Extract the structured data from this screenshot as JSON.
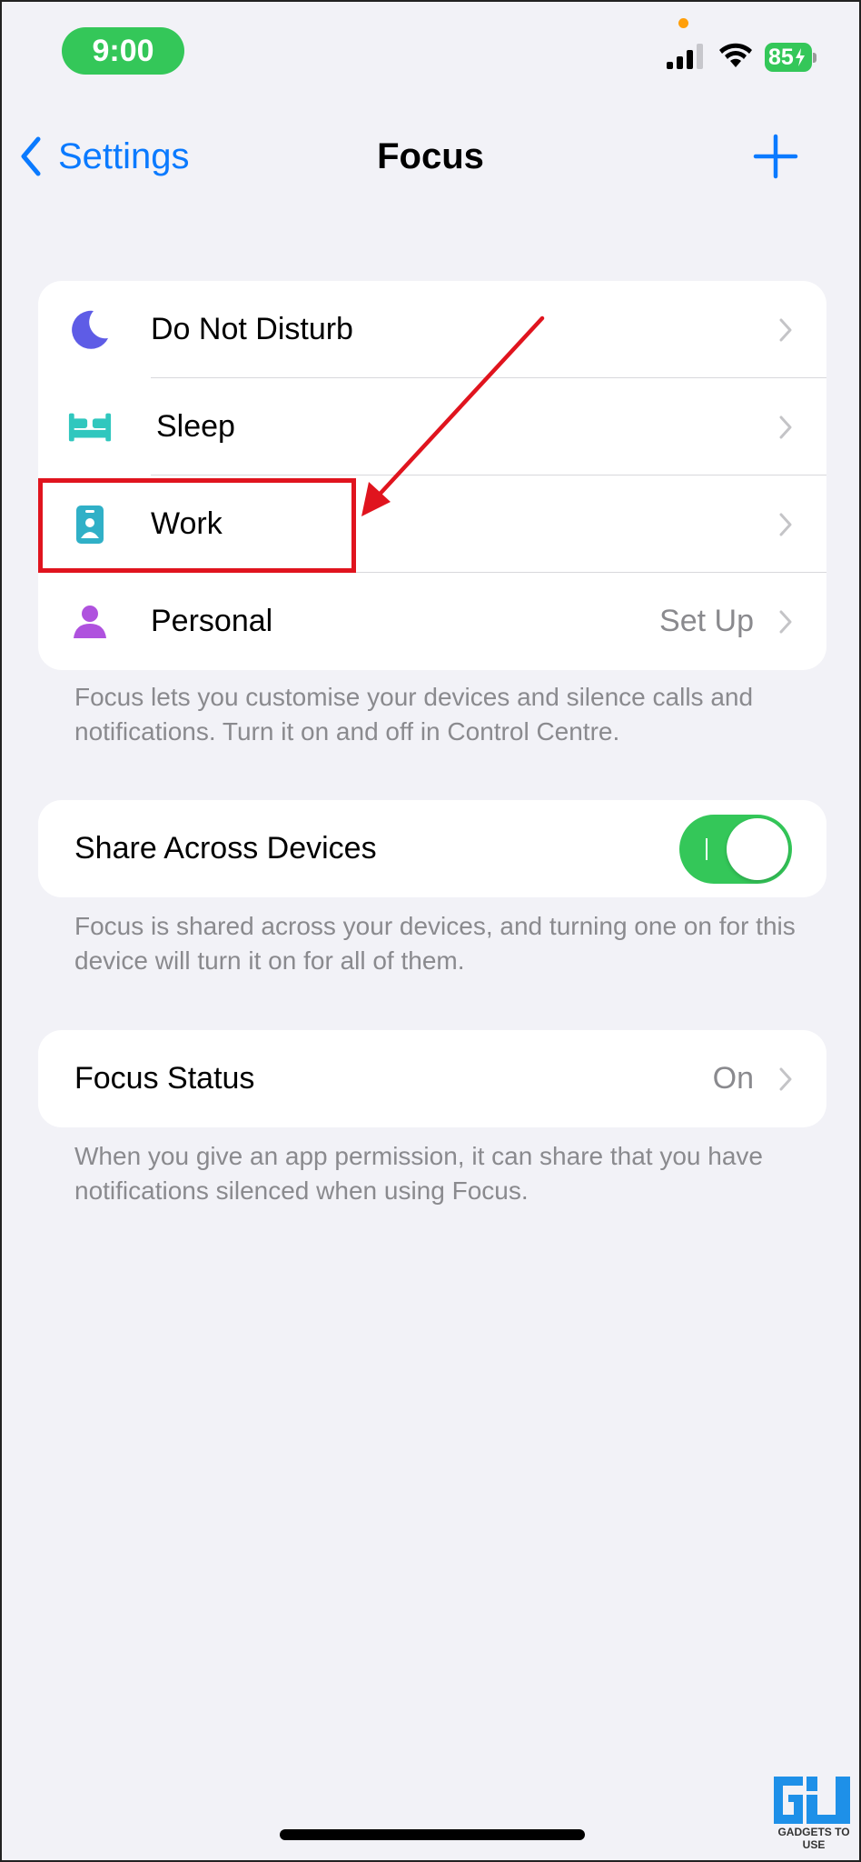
{
  "status_bar": {
    "time": "9:00",
    "battery": "85",
    "colors": {
      "pill": "#34C759",
      "dot": "#FF9F0A"
    }
  },
  "nav": {
    "back_label": "Settings",
    "title": "Focus",
    "add_icon": "plus-icon"
  },
  "focus_modes": [
    {
      "label": "Do Not Disturb",
      "icon": "moon-icon",
      "value": "",
      "color": "#5E5CE6"
    },
    {
      "label": "Sleep",
      "icon": "bed-icon",
      "value": "",
      "color": "#30C7BE"
    },
    {
      "label": "Work",
      "icon": "id-badge-icon",
      "value": "",
      "color": "#30B0C7"
    },
    {
      "label": "Personal",
      "icon": "person-icon",
      "value": "Set Up",
      "color": "#AF52DE"
    }
  ],
  "focus_footer": "Focus lets you customise your devices and silence calls and notifications. Turn it on and off in Control Centre.",
  "share": {
    "label": "Share Across Devices",
    "enabled": true,
    "footer": "Focus is shared across your devices, and turning one on for this device will turn it on for all of them."
  },
  "status": {
    "label": "Focus Status",
    "value": "On",
    "footer": "When you give an app permission, it can share that you have notifications silenced when using Focus."
  },
  "annotation": {
    "highlight_color": "#E0141E",
    "target": "Work"
  },
  "watermark": {
    "text": "GADGETS TO USE"
  }
}
